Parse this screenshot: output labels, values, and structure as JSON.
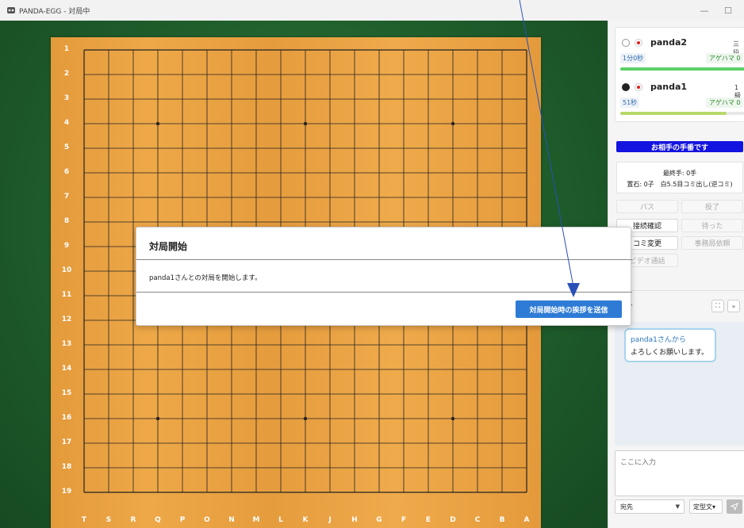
{
  "window": {
    "title": "PANDA-EGG - 対局中",
    "minimize": "—",
    "maximize": "☐"
  },
  "board": {
    "size": 19,
    "row_labels": [
      "1",
      "2",
      "3",
      "4",
      "5",
      "6",
      "7",
      "8",
      "9",
      "10",
      "11",
      "12",
      "13",
      "14",
      "15",
      "16",
      "17",
      "18",
      "19"
    ],
    "col_labels": [
      "T",
      "S",
      "R",
      "Q",
      "P",
      "O",
      "N",
      "M",
      "L",
      "K",
      "J",
      "H",
      "G",
      "F",
      "E",
      "D",
      "C",
      "B",
      "A"
    ],
    "colors": {
      "background": "#1f5d2b",
      "wood": "#eaa444",
      "line": "#222222"
    }
  },
  "players": [
    {
      "stone": "white",
      "name": "panda2",
      "rank": "三段",
      "time": "1分0秒",
      "agehama": "アゲハマ  0",
      "bar_color": "#5cd06a",
      "bar_fraction": 1.0
    },
    {
      "stone": "black",
      "name": "panda1",
      "rank": "1級",
      "time": "51秒",
      "agehama": "アゲハマ  0",
      "bar_color": "#b8d96a",
      "bar_fraction": 0.85
    }
  ],
  "game": {
    "turn_banner": "お相手の手番です",
    "last_move": "最終手: 0手",
    "handicap_komi": "置石: 0子　白5.5目コミ出し(逆コミ)",
    "buttons": {
      "pass": "パス",
      "resign": "投了",
      "connection_check": "接続確認",
      "undo": "待った",
      "komi_change": "コミ変更",
      "office_request": "事務局依頼",
      "video_call": "ビデオ通話"
    }
  },
  "chat": {
    "header": "会話",
    "expand_icon": "⛶",
    "collapse_icon": "»",
    "messages": [
      {
        "from": "panda1さんから",
        "text": "よろしくお願いします。"
      }
    ],
    "input_placeholder": "ここに入力",
    "recipient_label": "宛先",
    "template_label": "定型文▾",
    "send_icon": "send-icon"
  },
  "modal": {
    "title": "対局開始",
    "body": "panda1さんとの対局を開始します。",
    "button": "対局開始時の挨拶を送信"
  },
  "annotation_color": "#2a50b8"
}
